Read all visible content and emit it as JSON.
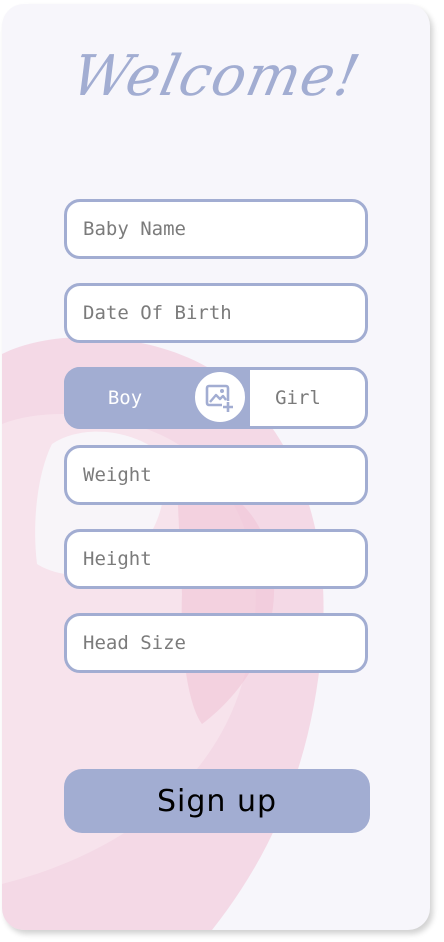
{
  "header": {
    "title": "Welcome!"
  },
  "form": {
    "baby_name": {
      "placeholder": "Baby Name",
      "value": ""
    },
    "date_of_birth": {
      "placeholder": "Date Of Birth",
      "value": ""
    },
    "gender": {
      "boy_label": "Boy",
      "girl_label": "Girl",
      "selected": "Boy"
    },
    "photo_icon": "add-photo-icon",
    "weight": {
      "placeholder": "Weight",
      "value": ""
    },
    "height": {
      "placeholder": "Height",
      "value": ""
    },
    "head_size": {
      "placeholder": "Head Size",
      "value": ""
    }
  },
  "actions": {
    "signup_label": "Sign up"
  },
  "colors": {
    "accent": "#a2add2",
    "background": "#f7f6fb",
    "decor_pink": "#f3c6da"
  }
}
